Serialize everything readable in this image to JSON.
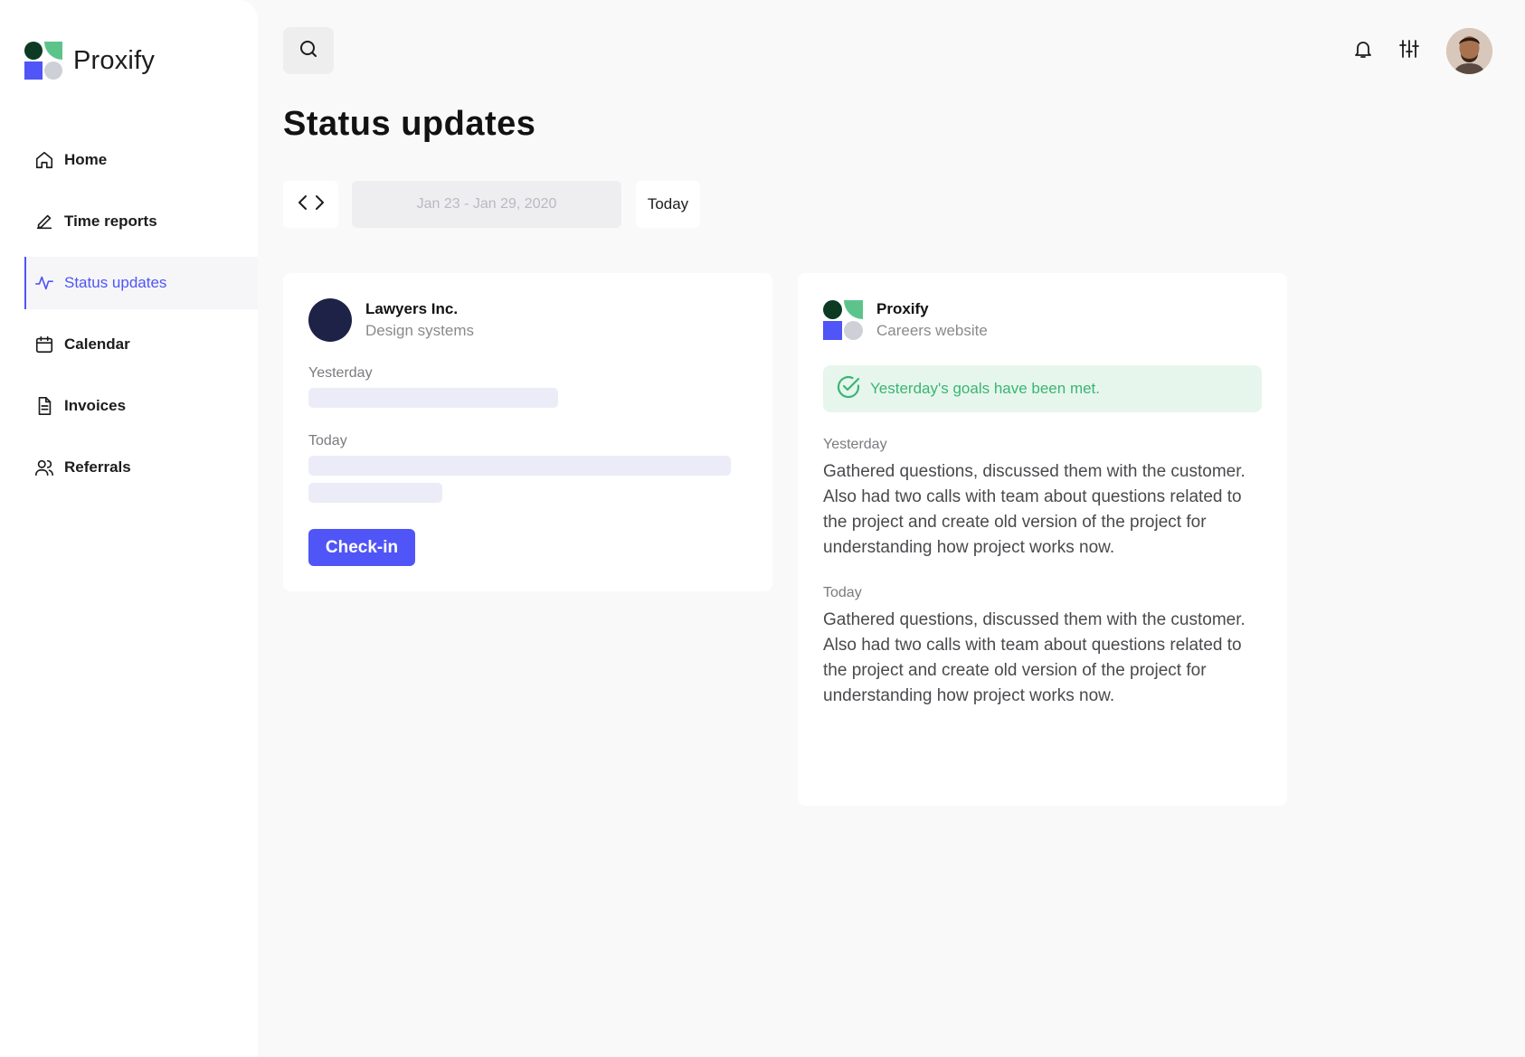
{
  "brand": {
    "name": "Proxify"
  },
  "sidebar": {
    "items": [
      {
        "label": "Home",
        "icon": "home-icon",
        "active": false
      },
      {
        "label": "Time reports",
        "icon": "pencil-icon",
        "active": false
      },
      {
        "label": "Status updates",
        "icon": "activity-icon",
        "active": true
      },
      {
        "label": "Calendar",
        "icon": "calendar-icon",
        "active": false
      },
      {
        "label": "Invoices",
        "icon": "document-icon",
        "active": false
      },
      {
        "label": "Referrals",
        "icon": "users-icon",
        "active": false
      }
    ]
  },
  "header": {
    "icons": [
      "search-icon",
      "bell-icon",
      "sliders-icon"
    ],
    "avatar": "user-avatar"
  },
  "page": {
    "title": "Status updates"
  },
  "date_controls": {
    "range": "Jan 23 - Jan 29, 2020",
    "today_label": "Today"
  },
  "cards": {
    "left": {
      "company": "Lawyers Inc.",
      "project": "Design systems",
      "yesterday_label": "Yesterday",
      "today_label": "Today",
      "button_label": "Check-in"
    },
    "right": {
      "company": "Proxify",
      "project": "Careers website",
      "banner": "Yesterday's goals have been met.",
      "yesterday_label": "Yesterday",
      "yesterday_text": "Gathered questions, discussed them with the customer. Also had two calls with team about questions related to the project and create old version of the project for understanding how project works now.",
      "today_label": "Today",
      "today_text": "Gathered questions, discussed them with the customer. Also had two calls with team about questions related to the project and create old version of the project for understanding how project works now."
    }
  },
  "colors": {
    "accent": "#4f55f6",
    "success": "#3bb574",
    "success_bg": "#e6f6ec",
    "logo_dark_green": "#0c3a23",
    "logo_green": "#5cc48a",
    "logo_gray": "#cdd0d6",
    "company_dot": "#1d2246"
  }
}
